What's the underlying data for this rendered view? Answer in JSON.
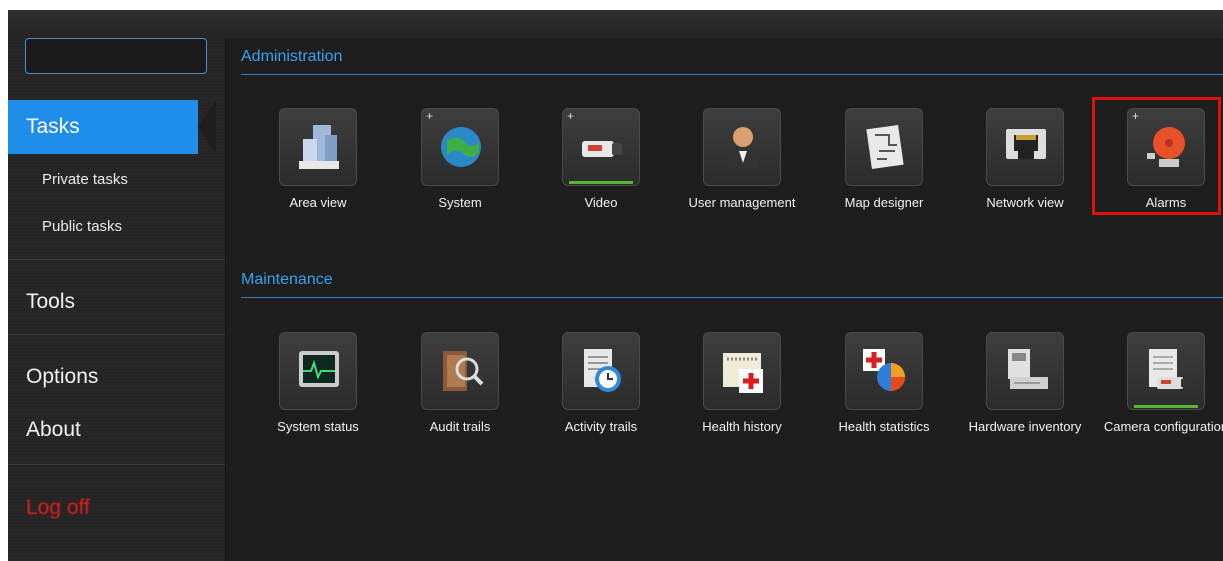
{
  "search": {
    "value": "",
    "placeholder": ""
  },
  "sidebar": {
    "tasks": "Tasks",
    "private_tasks": "Private tasks",
    "public_tasks": "Public tasks",
    "tools": "Tools",
    "options": "Options",
    "about": "About",
    "logoff": "Log off"
  },
  "sections": {
    "administration": {
      "title": "Administration",
      "items": [
        {
          "label": "Area view",
          "icon": "buildings-icon"
        },
        {
          "label": "System",
          "icon": "globe-icon"
        },
        {
          "label": "Video",
          "icon": "camera-icon"
        },
        {
          "label": "User management",
          "icon": "user-icon"
        },
        {
          "label": "Map designer",
          "icon": "map-icon"
        },
        {
          "label": "Network view",
          "icon": "network-port-icon"
        },
        {
          "label": "Alarms",
          "icon": "alarm-bell-icon"
        }
      ]
    },
    "maintenance": {
      "title": "Maintenance",
      "items": [
        {
          "label": "System status",
          "icon": "monitor-icon"
        },
        {
          "label": "Audit trails",
          "icon": "book-magnifier-icon"
        },
        {
          "label": "Activity trails",
          "icon": "document-clock-icon"
        },
        {
          "label": "Health history",
          "icon": "calendar-cross-icon"
        },
        {
          "label": "Health statistics",
          "icon": "pie-chart-cross-icon"
        },
        {
          "label": "Hardware inventory",
          "icon": "hardware-icon"
        },
        {
          "label": "Camera configuration",
          "icon": "camera-config-icon"
        }
      ]
    }
  },
  "colors": {
    "accent": "#1f8ee8",
    "section": "#3aa0f0",
    "logoff": "#e0201c",
    "highlight": "#e01010"
  }
}
